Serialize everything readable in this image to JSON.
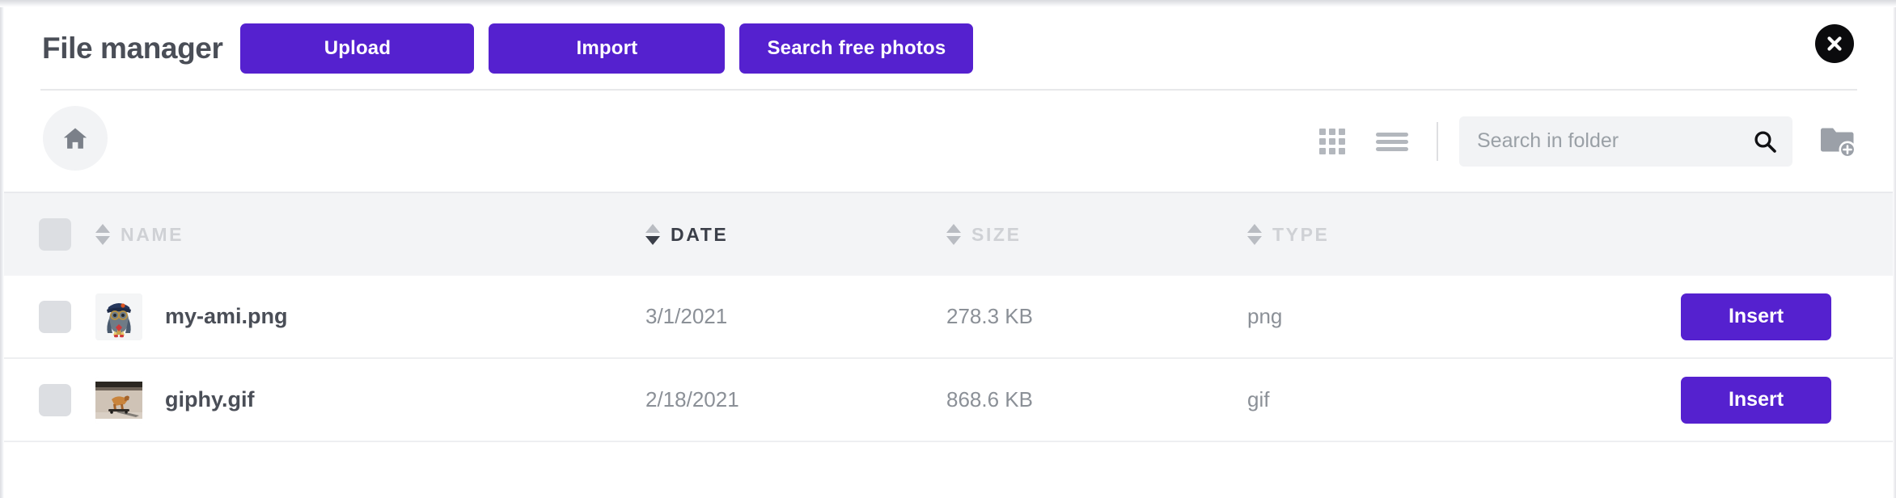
{
  "window": {
    "title": "File manager",
    "close_icon": "close-circle-icon"
  },
  "header": {
    "buttons": [
      {
        "label": "Upload",
        "name": "upload-button"
      },
      {
        "label": "Import",
        "name": "import-button"
      },
      {
        "label": "Search free photos",
        "name": "search-free-photos-button"
      }
    ],
    "accent_color": "#5521cf"
  },
  "toolbar": {
    "home_icon": "home-icon",
    "grid_view_icon": "grid-view-icon",
    "list_view_icon": "list-view-icon",
    "new_folder_icon": "new-folder-icon",
    "search": {
      "placeholder": "Search in folder",
      "value": "",
      "icon": "search-icon"
    }
  },
  "table": {
    "columns": [
      {
        "label": "NAME",
        "sorted": false,
        "direction": "none"
      },
      {
        "label": "DATE",
        "sorted": true,
        "direction": "desc"
      },
      {
        "label": "SIZE",
        "sorted": false,
        "direction": "none"
      },
      {
        "label": "TYPE",
        "sorted": false,
        "direction": "none"
      }
    ],
    "select_all_checked": false,
    "rows": [
      {
        "name": "my-ami.png",
        "date": "3/1/2021",
        "size": "278.3 KB",
        "type": "png",
        "thumbnail": "avatar-bird-thumbnail",
        "action_label": "Insert",
        "checked": false
      },
      {
        "name": "giphy.gif",
        "date": "2/18/2021",
        "size": "868.6 KB",
        "type": "gif",
        "thumbnail": "dog-skateboard-thumbnail",
        "action_label": "Insert",
        "checked": false
      }
    ]
  }
}
